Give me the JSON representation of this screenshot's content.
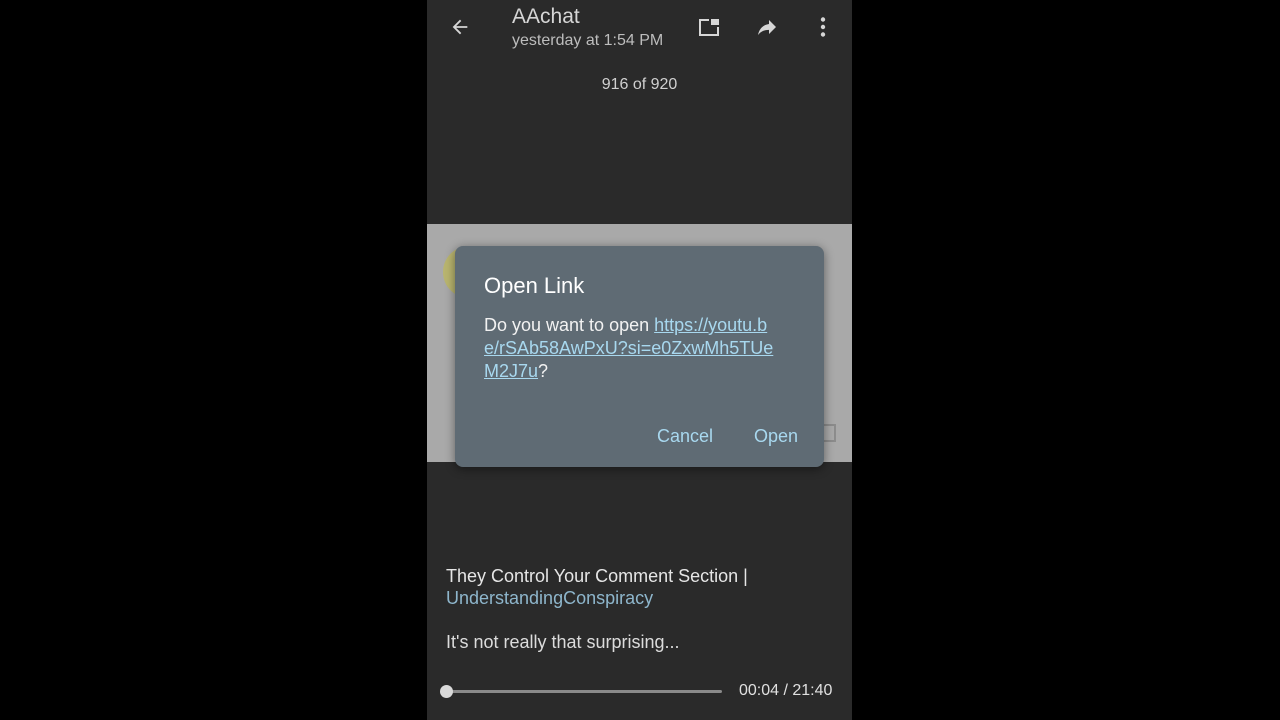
{
  "header": {
    "title": "AAchat",
    "subtitle": "yesterday at 1:54 PM",
    "icons": [
      "back-arrow-icon",
      "picture-in-picture-icon",
      "share-forward-icon",
      "more-vert-icon"
    ]
  },
  "counter": "916 of 920",
  "dialog": {
    "title": "Open Link",
    "prefix": "Do you want to open ",
    "link": "https://youtu.be/rSAb58AwPxU?si=e0ZxwMh5TUeM2J7u",
    "suffix": "?",
    "cancel_label": "Cancel",
    "open_label": "Open"
  },
  "caption": {
    "title": "They Control Your Comment Section | ",
    "hashtag": "UnderstandingConspiracy",
    "text": "It's not really that surprising..."
  },
  "player": {
    "time": "00:04 / 21:40",
    "progress": 0.003
  },
  "colors": {
    "background": "#2a2a2a",
    "dialog": "#5f6b74",
    "accent": "#a8d8ef"
  }
}
